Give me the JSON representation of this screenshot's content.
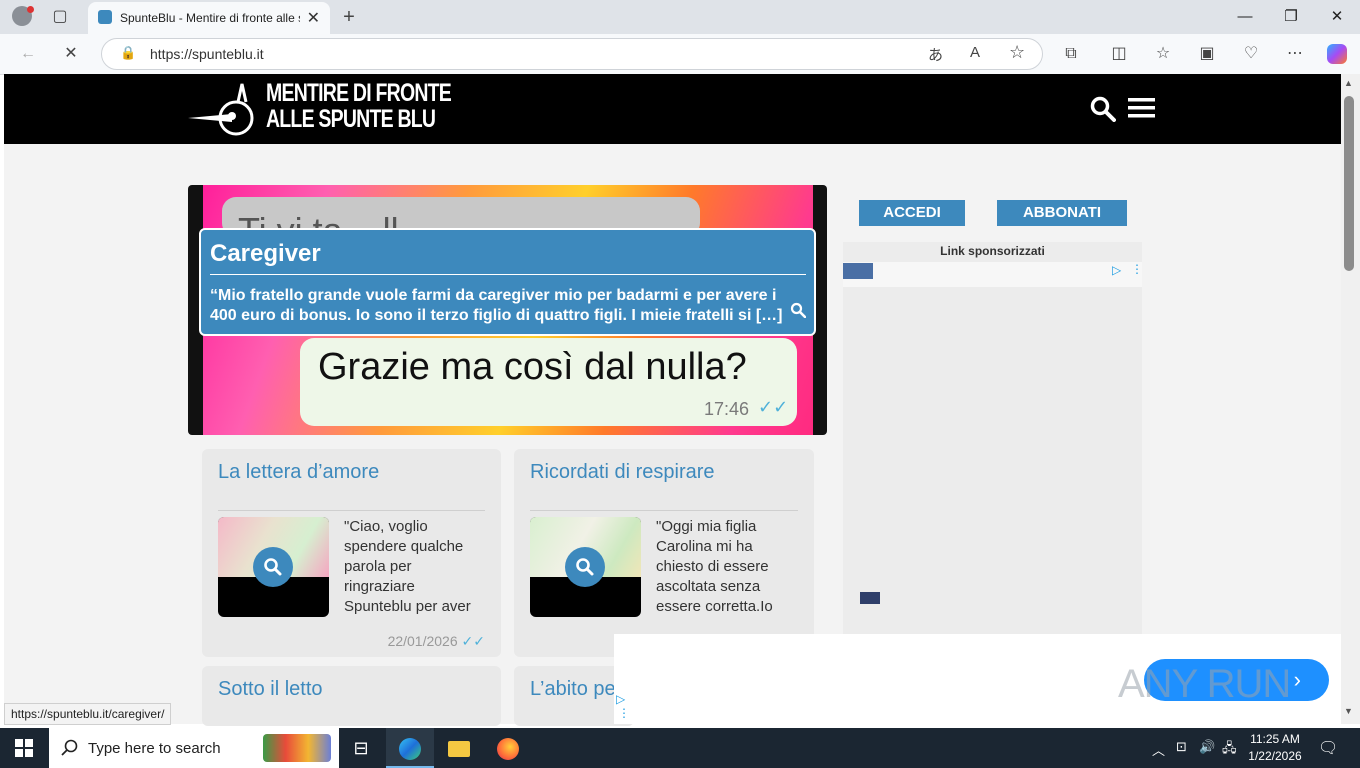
{
  "browser": {
    "tab_title": "SpunteBlu - Mentire di fronte alle spunte blu",
    "url": "https://spunteblu.it",
    "status_url": "https://spunteblu.it/caregiver/"
  },
  "site": {
    "logo_line1": "MENTIRE DI FRONTE",
    "logo_line2": "ALLE SPUNTE BLU",
    "login_label": "ACCEDI",
    "subscribe_label": "ABBONATI",
    "ad_label": "Link sponsorizzati"
  },
  "hero": {
    "title": "Caregiver",
    "excerpt_line1": "“Mio fratello grande vuole farmi da caregiver mio per badarmi e per avere i",
    "excerpt_line2": "400 euro di bonus. Io sono il terzo figlio di quattro figli. I mieie fratelli si […]",
    "image_text": "Grazie ma così dal nulla?",
    "image_time": "17:46",
    "image_top_text": "Ti vi ta... ll..."
  },
  "cards": [
    {
      "title": "La lettera d’amore",
      "excerpt": "\"Ciao, voglio spendere qualche parola per ringraziare Spunteblu per aver",
      "date": "22/01/2026"
    },
    {
      "title": "Ricordati di respirare",
      "excerpt": "\"Oggi mia figlia Carolina mi ha chiesto di essere ascoltata senza essere corretta.Io",
      "date": ""
    },
    {
      "title": "Sotto il letto"
    },
    {
      "title": "L’abito pe"
    }
  ],
  "watermark": {
    "text": "ANY RUN"
  },
  "taskbar": {
    "search_placeholder": "Type here to search",
    "time": "11:25 AM",
    "date": "1/22/2026"
  },
  "colors": {
    "brand_blue": "#3d89bd",
    "header_black": "#000000"
  }
}
